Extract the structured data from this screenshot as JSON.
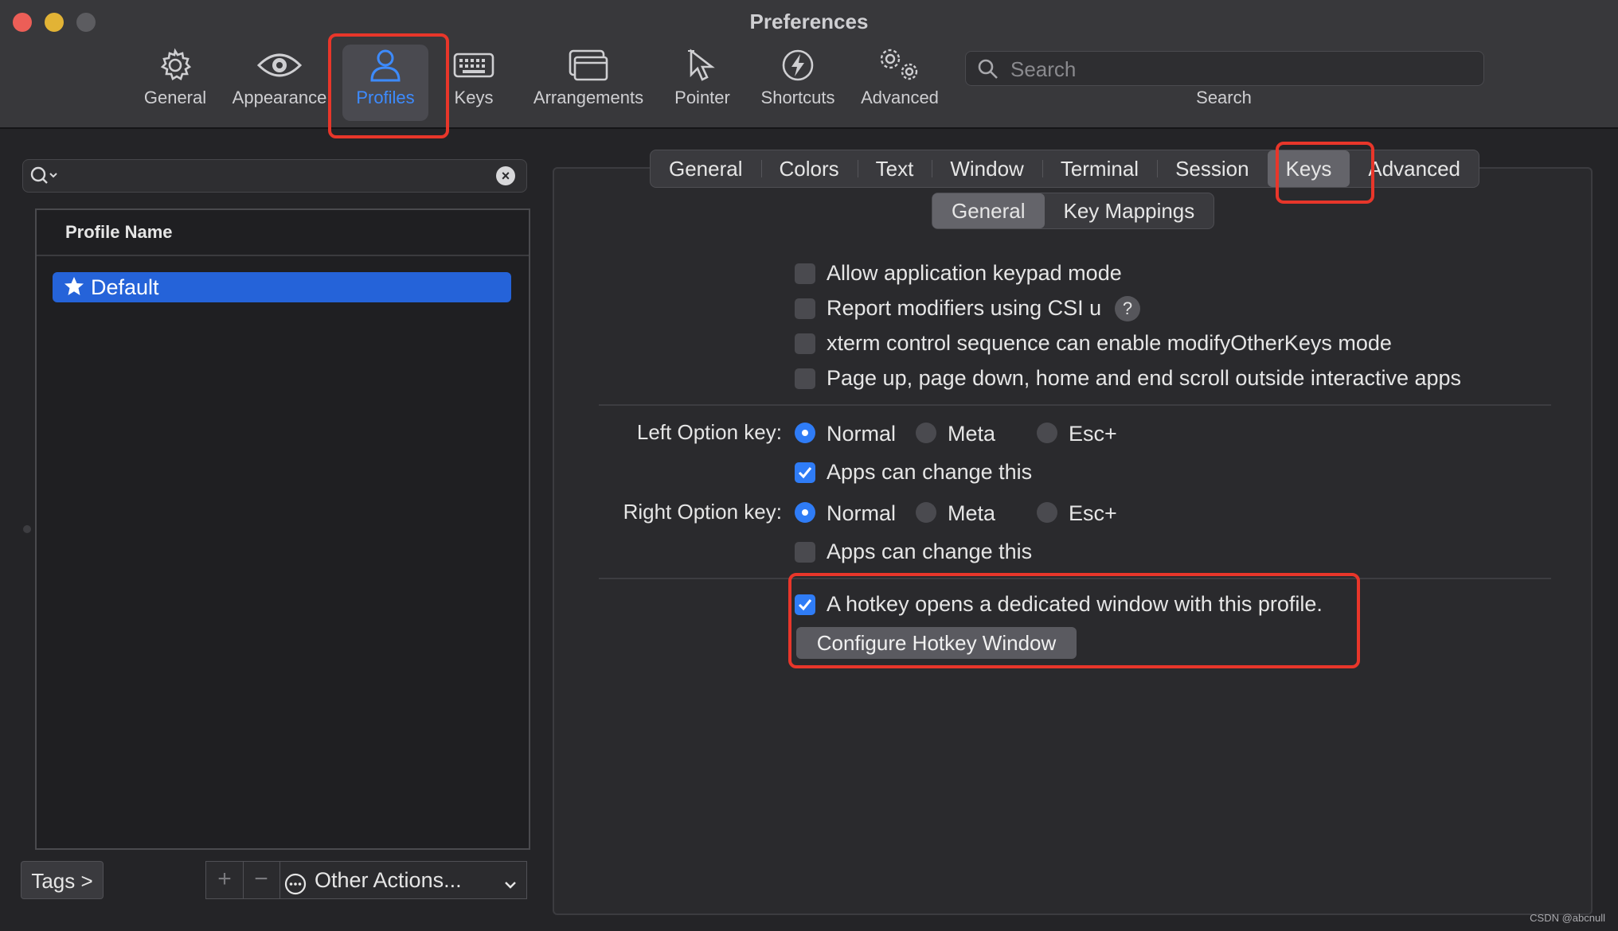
{
  "window": {
    "title": "Preferences"
  },
  "toolbar": {
    "items": [
      {
        "label": "General",
        "icon": "gear-icon"
      },
      {
        "label": "Appearance",
        "icon": "eye-icon"
      },
      {
        "label": "Profiles",
        "icon": "person-icon",
        "active": true
      },
      {
        "label": "Keys",
        "icon": "keyboard-icon"
      },
      {
        "label": "Arrangements",
        "icon": "window-stack-icon"
      },
      {
        "label": "Pointer",
        "icon": "pointer-icon"
      },
      {
        "label": "Shortcuts",
        "icon": "lightning-icon"
      },
      {
        "label": "Advanced",
        "icon": "gears-icon"
      }
    ],
    "search": {
      "placeholder": "Search",
      "caption": "Search"
    }
  },
  "profiles": {
    "column_header": "Profile Name",
    "items": [
      {
        "name": "Default",
        "selected": true,
        "star": true
      }
    ],
    "tags_button": "Tags >",
    "add_symbol": "+",
    "remove_symbol": "−",
    "other_actions": "Other Actions..."
  },
  "tabs": {
    "items": [
      "General",
      "Colors",
      "Text",
      "Window",
      "Terminal",
      "Session",
      "Keys",
      "Advanced"
    ],
    "active": "Keys"
  },
  "subtabs": {
    "items": [
      "General",
      "Key Mappings"
    ],
    "active": "General"
  },
  "keys_general": {
    "options": [
      {
        "label": "Allow application keypad mode",
        "checked": false
      },
      {
        "label": "Report modifiers using CSI u",
        "checked": false,
        "help": "?"
      },
      {
        "label": "xterm control sequence can enable modifyOtherKeys mode",
        "checked": false
      },
      {
        "label": "Page up, page down, home and end scroll outside interactive apps",
        "checked": false
      }
    ],
    "left_option": {
      "label": "Left Option key:",
      "choices": [
        "Normal",
        "Meta",
        "Esc+"
      ],
      "selected": "Normal",
      "apps_can_change": {
        "label": "Apps can change this",
        "checked": true
      }
    },
    "right_option": {
      "label": "Right Option key:",
      "choices": [
        "Normal",
        "Meta",
        "Esc+"
      ],
      "selected": "Normal",
      "apps_can_change": {
        "label": "Apps can change this",
        "checked": false
      }
    },
    "hotkey": {
      "label": "A hotkey opens a dedicated window with this profile.",
      "checked": true,
      "button": "Configure Hotkey Window"
    }
  },
  "colors": {
    "accent": "#2f7cf6",
    "selection": "#2563d9",
    "highlight_box": "#e8362a"
  },
  "watermark": "CSDN @abcnull"
}
